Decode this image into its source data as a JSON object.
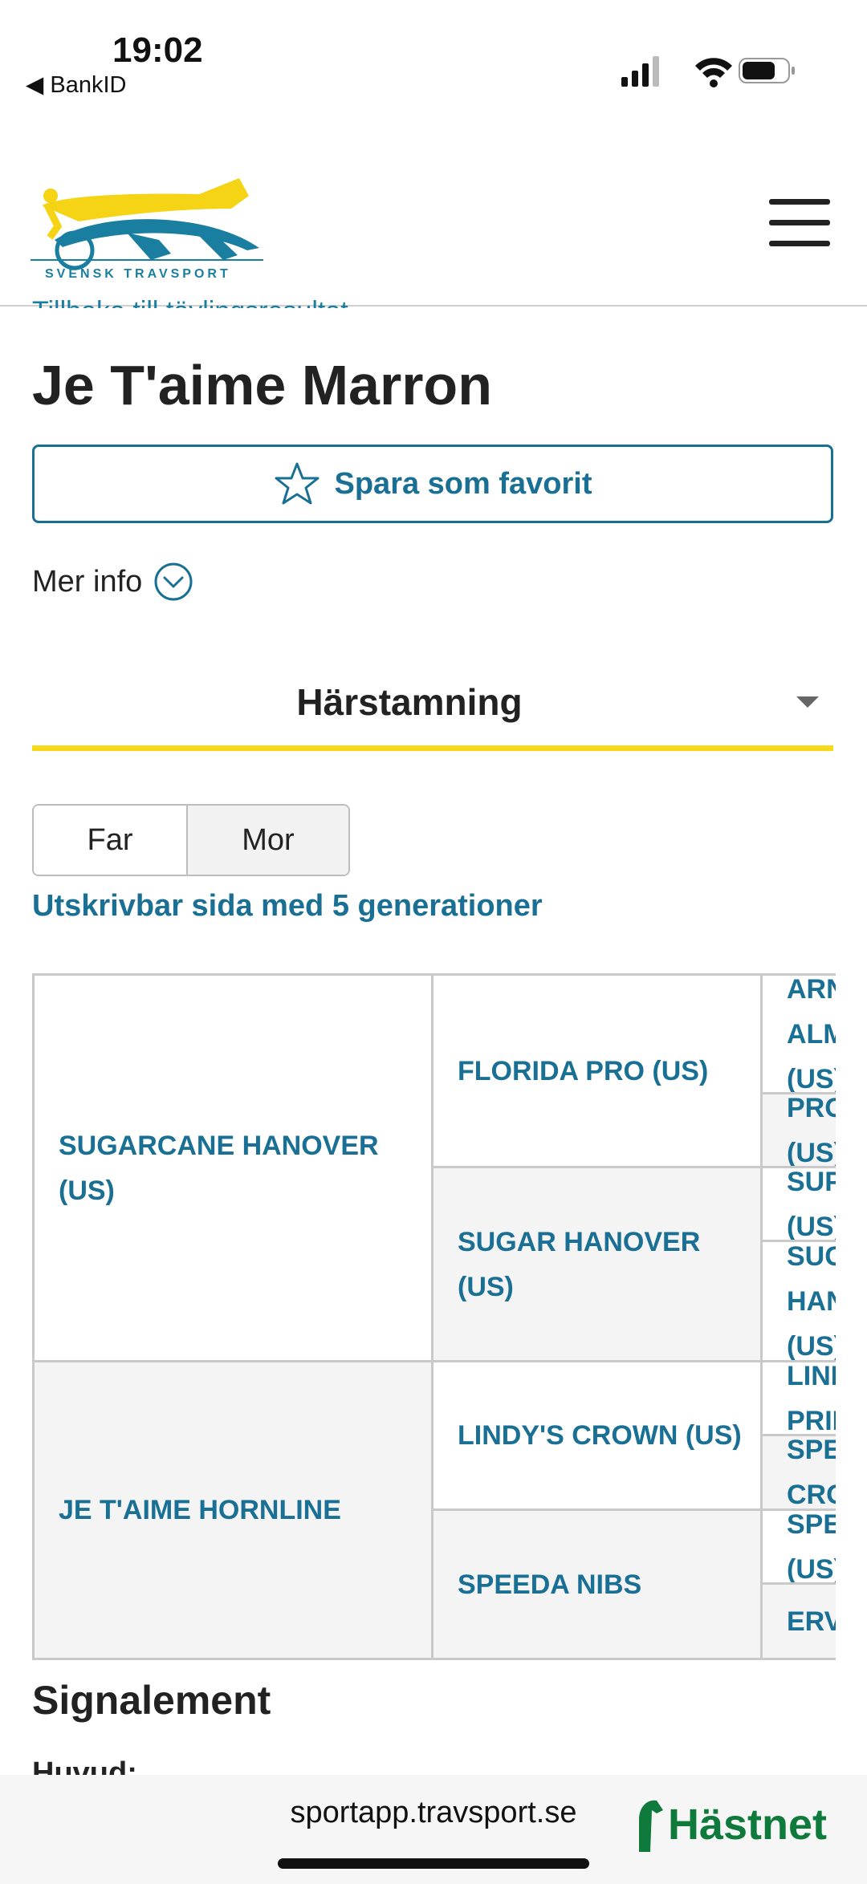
{
  "status_bar": {
    "time": "19:02",
    "back_app": "◀ BankID"
  },
  "header": {
    "logo_text": "SVENSK TRAVSPORT"
  },
  "page": {
    "back_link": "Tillbaka till tävlingsresultat",
    "horse_name": "Je T'aime Marron",
    "favorite_label": "Spara som favorit",
    "more_info": "Mer info",
    "section_select": "Härstamning",
    "tabs": {
      "far": "Far",
      "mor": "Mor"
    },
    "print_link": "Utskrivbar sida med 5 generationer"
  },
  "pedigree": {
    "gen1": [
      "SUGARCANE HANOVER (US)",
      "JE T'AIME HORNLINE"
    ],
    "gen2": [
      "FLORIDA PRO (US)",
      "SUGAR HANOVER (US)",
      "LINDY'S CROWN (US)",
      "SPEEDA NIBS"
    ],
    "gen3": [
      "ARNIE ALMAHURST (US)",
      "PRO BABE (US)",
      "SUPER BOWL (US)",
      "SUGAR HANOVER (US)",
      "LINDY'S PRIDE (US)",
      "SPEEDY CROWN (US)",
      "SPEEDY SCOT (US)",
      "ERVANA"
    ]
  },
  "signalement": {
    "title": "Signalement",
    "huvud": "Huvud:"
  },
  "browser": {
    "url": "sportapp.travsport.se",
    "brand": "Hästnet"
  },
  "colors": {
    "link": "#1a6f94",
    "accent_yellow": "#f7d91a",
    "hastnet_green": "#0e7a3b"
  }
}
